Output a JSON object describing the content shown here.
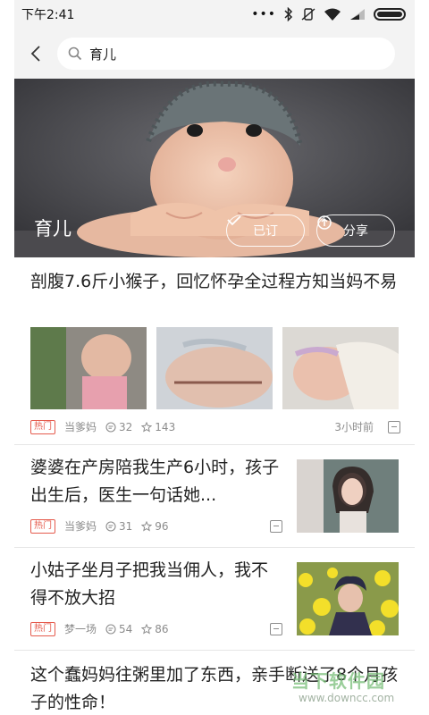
{
  "status": {
    "time": "下午2:41",
    "dots": "•••"
  },
  "search": {
    "query": "育儿"
  },
  "banner": {
    "title": "育儿",
    "subscribe_label": "已订",
    "share_label": "分享"
  },
  "articles": [
    {
      "title": "剖腹7.6斤小猴子，回忆怀孕全过程方知当妈不易",
      "tag": "热门",
      "author": "当爹妈",
      "comments": "32",
      "stars": "143",
      "time": "3小时前"
    },
    {
      "title": "婆婆在产房陪我生产6小时，孩子出生后，医生一句话她...",
      "tag": "热门",
      "author": "当爹妈",
      "comments": "31",
      "stars": "96"
    },
    {
      "title": "小姑子坐月子把我当佣人，我不得不放大招",
      "tag": "热门",
      "author": "梦一场",
      "comments": "54",
      "stars": "86"
    },
    {
      "title": "这个蠢妈妈往粥里加了东西，亲手断送了8个月孩子的性命！"
    }
  ],
  "watermark": {
    "brand": "当下软件园",
    "url": "www.downcc.com"
  }
}
